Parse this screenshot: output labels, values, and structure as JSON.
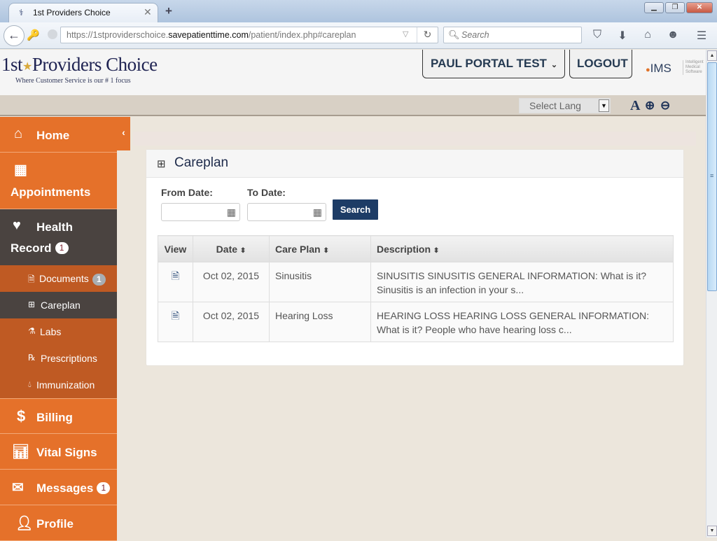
{
  "browser": {
    "tab_title": "1st Providers Choice",
    "url_prefix": "https://1stproviderschoice.",
    "url_domain": "savepatienttime.com",
    "url_path": "/patient/index.php#careplan",
    "search_placeholder": "Search"
  },
  "header": {
    "logo_text": "1st",
    "logo_text_2": "Providers Choice",
    "tagline": "Where Customer Service is our # 1 focus",
    "user_menu_label": "PAUL PORTAL TEST",
    "logout_label": "LOGOUT",
    "vendor_logo": "IMS",
    "vendor_sub": "Intelligent Medical Software",
    "language_select": "Select Lang",
    "font_icon_label": "A"
  },
  "sidebar": {
    "items": [
      {
        "label": "Home",
        "icon": "home-icon"
      },
      {
        "label": "Appointments",
        "icon": "calendar-icon"
      },
      {
        "label": "Health",
        "label2": "Record",
        "badge": "1",
        "icon": "heartbeat-icon"
      },
      {
        "label": "Billing",
        "icon": "dollar-icon"
      },
      {
        "label": "Vital Signs",
        "icon": "bar-chart-icon"
      },
      {
        "label": "Messages",
        "badge": "1",
        "icon": "envelope-icon"
      },
      {
        "label": "Profile",
        "icon": "user-icon"
      }
    ],
    "sub_items": [
      {
        "label": "Documents",
        "badge": "1",
        "icon": "file-icon"
      },
      {
        "label": "Careplan",
        "icon": "medkit-icon"
      },
      {
        "label": "Labs",
        "icon": "flask-icon"
      },
      {
        "label": "Prescriptions",
        "icon": "prescription-icon"
      },
      {
        "label": "Immunization",
        "icon": "drop-icon"
      }
    ]
  },
  "main": {
    "panel_title": "Careplan",
    "from_label": "From Date:",
    "to_label": "To Date:",
    "from_value": "",
    "to_value": "",
    "search_label": "Search",
    "table": {
      "headers": [
        "View",
        "Date",
        "Care Plan",
        "Description"
      ],
      "rows": [
        {
          "date": "Oct 02, 2015",
          "plan": "Sinusitis",
          "description": "SINUSITIS SINUSITIS GENERAL INFORMATION: What is it? Sinusitis is an infection in your s..."
        },
        {
          "date": "Oct 02, 2015",
          "plan": "Hearing Loss",
          "description": "HEARING LOSS HEARING LOSS GENERAL INFORMATION: What is it? People who have hearing loss c..."
        }
      ]
    }
  },
  "colors": {
    "sidebar_orange": "#e5712a",
    "sidebar_sub": "#bf5a23",
    "sidebar_active": "#4a4340",
    "primary_button": "#1d3c66"
  }
}
